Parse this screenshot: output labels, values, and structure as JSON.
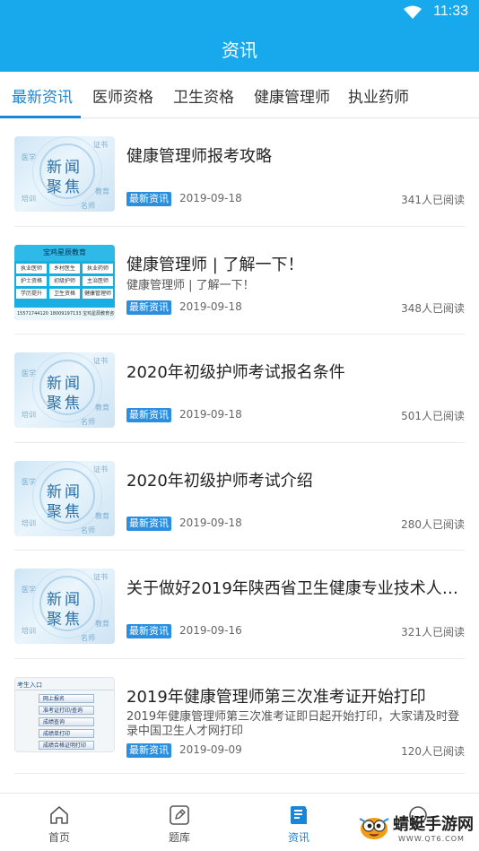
{
  "status_bar": {
    "time": "11:33"
  },
  "header": {
    "title": "资讯"
  },
  "tabs": [
    {
      "label": "最新资讯",
      "active": true
    },
    {
      "label": "医师资格",
      "active": false
    },
    {
      "label": "卫生资格",
      "active": false
    },
    {
      "label": "健康管理师",
      "active": false
    },
    {
      "label": "执业药师",
      "active": false
    }
  ],
  "thumb_news": {
    "line1": "新闻",
    "line2": "聚焦",
    "w1": "医学",
    "w2": "证书",
    "w3": "培训",
    "w4": "教育",
    "w5": "名师"
  },
  "thumb_ad": {
    "heading": "宝鸡星辰教育",
    "cells": [
      "执业医师",
      "乡村医生",
      "执业药师",
      "护士资格",
      "初级护师",
      "主治医师",
      "学历提升",
      "卫生资格",
      "健康管理师"
    ],
    "footer": "15571744120  18009197133  宝鸡星辰教育咨询有限公司"
  },
  "thumb_form": {
    "heading": "考生入口",
    "buttons": [
      "网上报名",
      "准考证打印/查询",
      "成绩查询",
      "成绩单打印",
      "成绩合格证明打印"
    ]
  },
  "news": [
    {
      "title": "健康管理师报考攻略",
      "summary": "",
      "tag": "最新资讯",
      "date": "2019-09-18",
      "reads": "341人已阅读"
    },
    {
      "title": "健康管理师 | 了解一下！",
      "summary": "健康管理师 | 了解一下！",
      "tag": "最新资讯",
      "date": "2019-09-18",
      "reads": "348人已阅读"
    },
    {
      "title": "2020年初级护师考试报名条件",
      "summary": "",
      "tag": "最新资讯",
      "date": "2019-09-18",
      "reads": "501人已阅读"
    },
    {
      "title": "2020年初级护师考试介绍",
      "summary": "",
      "tag": "最新资讯",
      "date": "2019-09-18",
      "reads": "280人已阅读"
    },
    {
      "title": "关于做好2019年陕西省卫生健康专业技术人员...",
      "summary": "",
      "tag": "最新资讯",
      "date": "2019-09-16",
      "reads": "321人已阅读"
    },
    {
      "title": "2019年健康管理师第三次准考证开始打印",
      "summary": "2019年健康管理师第三次准考证即日起开始打印，大家请及时登录中国卫生人才网打印",
      "tag": "最新资讯",
      "date": "2019-09-09",
      "reads": "120人已阅读"
    }
  ],
  "bottom_nav": [
    {
      "label": "首页",
      "icon": "home-icon",
      "active": false
    },
    {
      "label": "题库",
      "icon": "edit-icon",
      "active": false
    },
    {
      "label": "资讯",
      "icon": "document-icon",
      "active": true
    },
    {
      "label": "",
      "icon": "profile-icon",
      "active": false
    }
  ],
  "watermark": {
    "title": "蜻蜓手游网",
    "url": "WWW.QT6.COM"
  },
  "colors": {
    "header": "#17a9ec",
    "accent": "#1a86d8",
    "tag": "#2a8fe0"
  }
}
